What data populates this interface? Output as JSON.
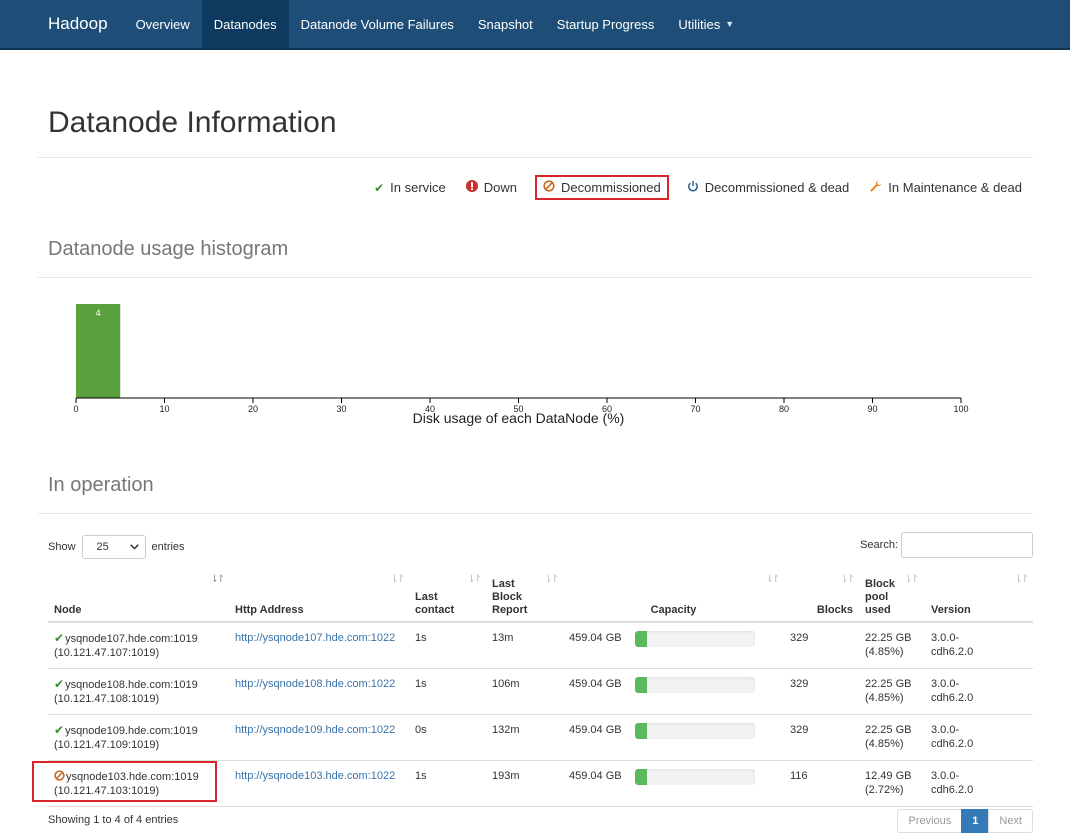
{
  "nav": {
    "brand": "Hadoop",
    "items": [
      {
        "label": "Overview",
        "active": false
      },
      {
        "label": "Datanodes",
        "active": true
      },
      {
        "label": "Datanode Volume Failures",
        "active": false
      },
      {
        "label": "Snapshot",
        "active": false
      },
      {
        "label": "Startup Progress",
        "active": false
      },
      {
        "label": "Utilities",
        "active": false,
        "dropdown": true
      }
    ]
  },
  "page": {
    "title": "Datanode Information"
  },
  "legend": [
    {
      "icon": "check-icon",
      "glyph": "✔",
      "label": "In service",
      "color": "#3c8d32"
    },
    {
      "icon": "exclamation-circle-icon",
      "glyph": "❗",
      "label": "Down",
      "color": "#c9302c"
    },
    {
      "icon": "ban-icon",
      "glyph": "⊘",
      "label": "Decommissioned",
      "color": "#c7661c",
      "highlighted": true
    },
    {
      "icon": "power-icon",
      "glyph": "⏻",
      "label": "Decommissioned & dead",
      "color": "#2a5d8f"
    },
    {
      "icon": "wrench-icon",
      "glyph": "🔧",
      "label": "In Maintenance & dead",
      "color": "#e8841a"
    }
  ],
  "histogram": {
    "title": "Datanode usage histogram",
    "chart_data": {
      "type": "bar",
      "bins": [
        {
          "from": 0,
          "to": 5,
          "count": 4
        }
      ],
      "xlabel": "Disk usage of each DataNode (%)",
      "xlim": [
        0,
        100
      ],
      "xticks": [
        0,
        10,
        20,
        30,
        40,
        50,
        60,
        70,
        80,
        90,
        100
      ],
      "bar_color": "#5aa03c"
    }
  },
  "operation": {
    "title": "In operation",
    "show_label": "Show",
    "entries_value": "25",
    "entries_label": "entries",
    "search_label": "Search:",
    "search_value": ""
  },
  "table": {
    "headers": [
      {
        "label": "Node",
        "sort": "asc"
      },
      {
        "label": "Http Address",
        "sort": "both"
      },
      {
        "label": "Last contact",
        "sort": "both"
      },
      {
        "label": "Last Block Report",
        "sort": "both"
      },
      {
        "label": "Capacity",
        "sort": "both"
      },
      {
        "label": "Blocks",
        "sort": "both"
      },
      {
        "label": "Block pool used",
        "sort": "both"
      },
      {
        "label": "Version",
        "sort": "both"
      }
    ],
    "rows": [
      {
        "status": "in-service",
        "glyph": "✔",
        "color": "#3c8d32",
        "node": "ysqnode107.hde.com:1019",
        "ip": "(10.121.47.107:1019)",
        "http": "http://ysqnode107.hde.com:1022",
        "last_contact": "1s",
        "last_report": "13m",
        "capacity": "459.04 GB",
        "usage": 0.0485,
        "blocks": "329",
        "bp_used": "22.25 GB",
        "bp_pct": "(4.85%)",
        "version1": "3.0.0-",
        "version2": "cdh6.2.0"
      },
      {
        "status": "in-service",
        "glyph": "✔",
        "color": "#3c8d32",
        "node": "ysqnode108.hde.com:1019",
        "ip": "(10.121.47.108:1019)",
        "http": "http://ysqnode108.hde.com:1022",
        "last_contact": "1s",
        "last_report": "106m",
        "capacity": "459.04 GB",
        "usage": 0.0485,
        "blocks": "329",
        "bp_used": "22.25 GB",
        "bp_pct": "(4.85%)",
        "version1": "3.0.0-",
        "version2": "cdh6.2.0"
      },
      {
        "status": "in-service",
        "glyph": "✔",
        "color": "#3c8d32",
        "node": "ysqnode109.hde.com:1019",
        "ip": "(10.121.47.109:1019)",
        "http": "http://ysqnode109.hde.com:1022",
        "last_contact": "0s",
        "last_report": "132m",
        "capacity": "459.04 GB",
        "usage": 0.0485,
        "blocks": "329",
        "bp_used": "22.25 GB",
        "bp_pct": "(4.85%)",
        "version1": "3.0.0-",
        "version2": "cdh6.2.0"
      },
      {
        "status": "decommissioned",
        "glyph": "⊘",
        "color": "#c7661c",
        "node": "ysqnode103.hde.com:1019",
        "ip": "(10.121.47.103:1019)",
        "http": "http://ysqnode103.hde.com:1022",
        "last_contact": "1s",
        "last_report": "193m",
        "capacity": "459.04 GB",
        "usage": 0.0272,
        "blocks": "116",
        "bp_used": "12.49 GB",
        "bp_pct": "(2.72%)",
        "version1": "3.0.0-",
        "version2": "cdh6.2.0"
      }
    ]
  },
  "footer": {
    "info": "Showing 1 to 4 of 4 entries",
    "prev": "Previous",
    "page": "1",
    "next": "Next"
  }
}
